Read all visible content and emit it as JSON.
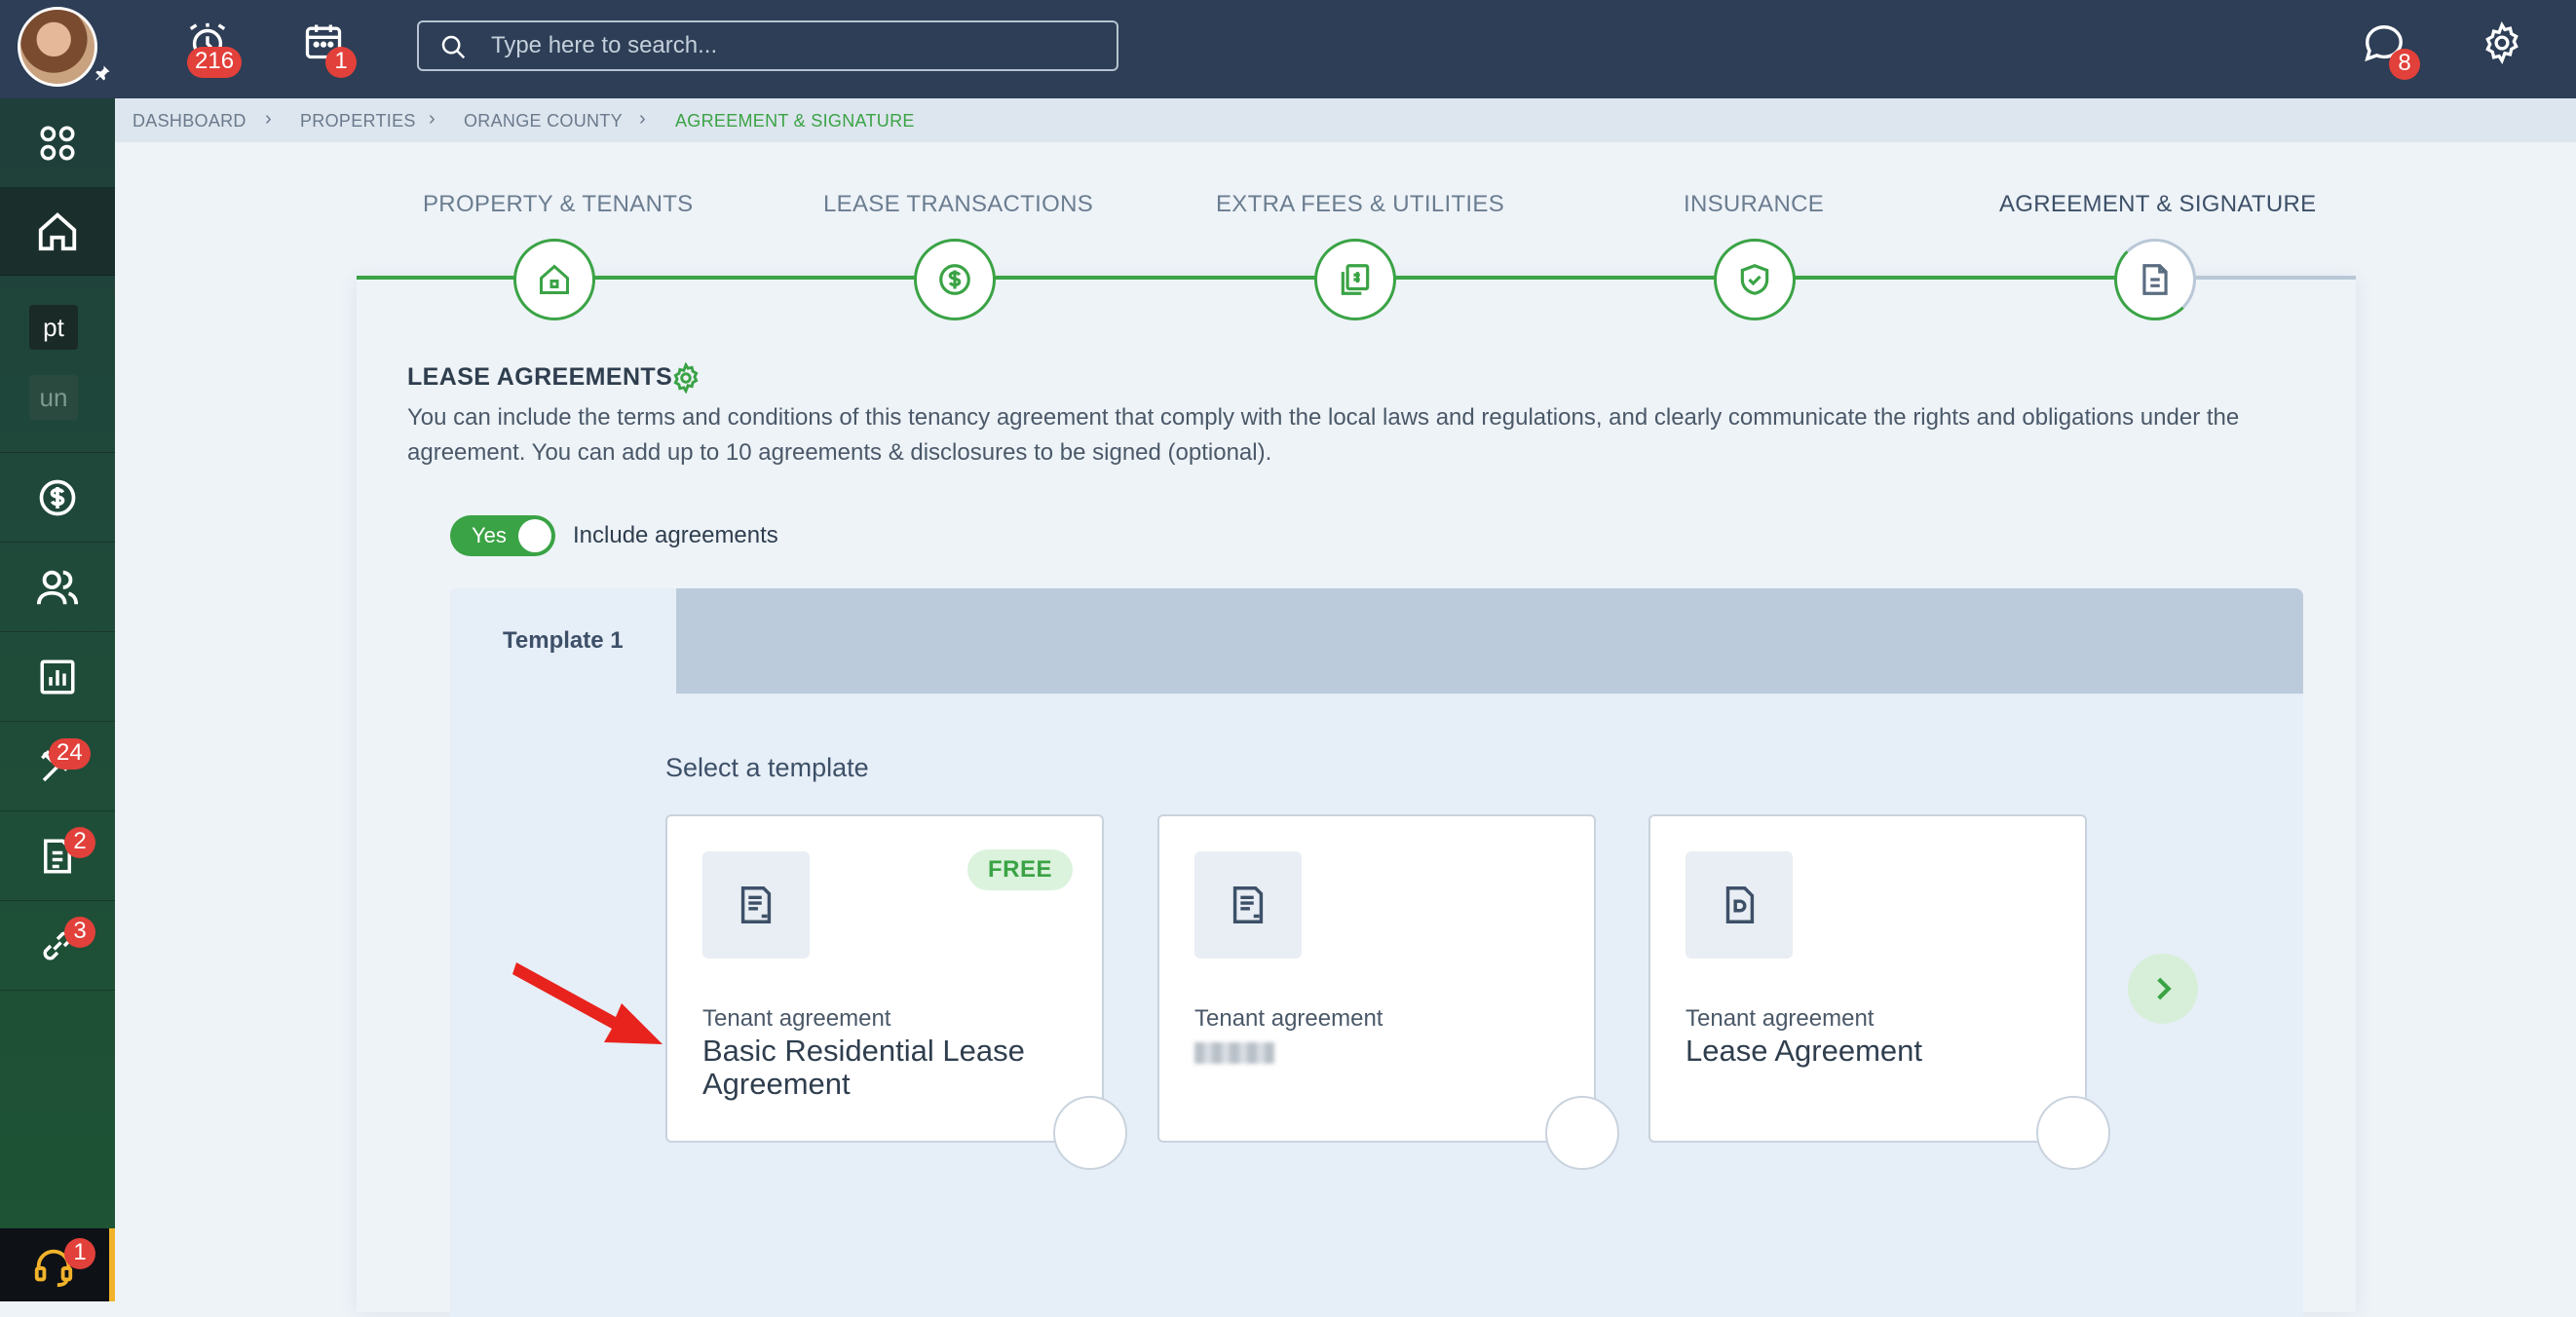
{
  "topbar": {
    "alarm_count": "216",
    "calendar_count": "1",
    "search_placeholder": "Type here to search...",
    "chat_count": "8"
  },
  "sidebar": {
    "chip_pt": "pt",
    "chip_un": "un",
    "tools_badge": "24",
    "docs_badge": "2",
    "links_badge": "3",
    "support_badge": "1"
  },
  "breadcrumb": [
    "DASHBOARD",
    "PROPERTIES",
    "ORANGE COUNTY",
    "AGREEMENT & SIGNATURE"
  ],
  "steps": [
    {
      "label": "PROPERTY & TENANTS",
      "icon": "house-icon"
    },
    {
      "label": "LEASE TRANSACTIONS",
      "icon": "dollar-icon"
    },
    {
      "label": "EXTRA FEES & UTILITIES",
      "icon": "bills-icon"
    },
    {
      "label": "INSURANCE",
      "icon": "shield-check-icon"
    },
    {
      "label": "AGREEMENT & SIGNATURE",
      "icon": "document-icon"
    }
  ],
  "section": {
    "title": "LEASE AGREEMENTS",
    "description": "You can include the terms and conditions of this tenancy agreement that comply with the local laws and regulations, and clearly communicate the rights and obligations under the agreement. You can add up to 10 agreements & disclosures to be signed (optional).",
    "toggle_state": "Yes",
    "toggle_label": "Include agreements"
  },
  "tabs": [
    "Template 1"
  ],
  "templates": {
    "heading": "Select a template",
    "cards": [
      {
        "category": "Tenant agreement",
        "name": "Basic Residential Lease Agreement",
        "badge": "FREE"
      },
      {
        "category": "Tenant agreement",
        "name": ""
      },
      {
        "category": "Tenant agreement",
        "name": "Lease Agreement"
      }
    ]
  },
  "colors": {
    "topbar": "#2d3e56",
    "accent_green": "#3aa345",
    "badge_red": "#e2403a",
    "annotation_arrow": "#e8221c"
  }
}
